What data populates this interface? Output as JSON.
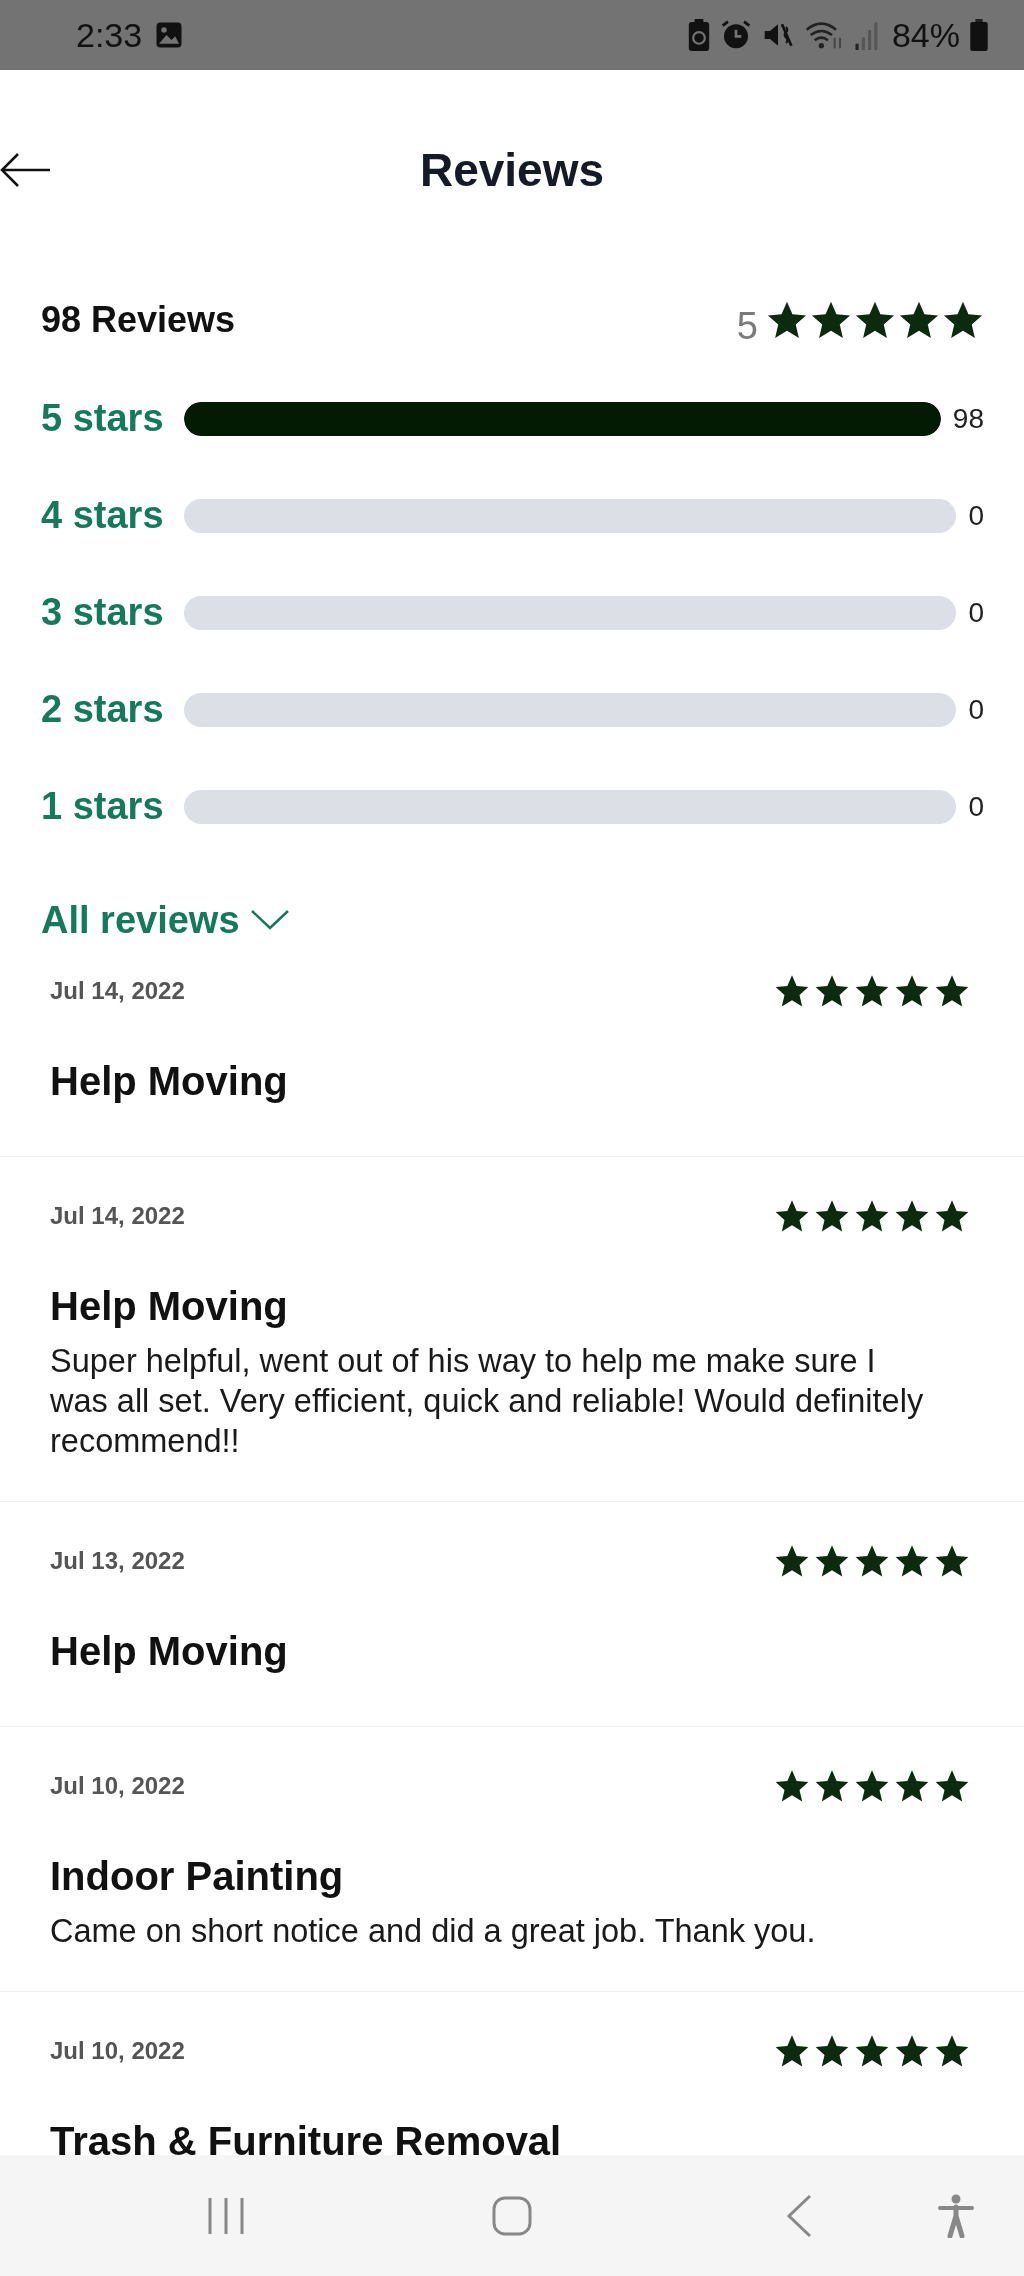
{
  "status_bar": {
    "time": "2:33",
    "battery": "84%"
  },
  "header": {
    "title": "Reviews"
  },
  "summary": {
    "count_label": "98 Reviews",
    "rating": "5",
    "stars": 5,
    "breakdown": [
      {
        "label": "5 stars",
        "level": 1,
        "count": "98"
      },
      {
        "label": "4 stars",
        "level": 0,
        "count": "0"
      },
      {
        "label": "3 stars",
        "level": 0,
        "count": "0"
      },
      {
        "label": "2 stars",
        "level": 0,
        "count": "0"
      },
      {
        "label": "1 stars",
        "level": 0,
        "count": "0"
      }
    ]
  },
  "filter": {
    "label": "All reviews"
  },
  "reviews": [
    {
      "date": "Jul 14, 2022",
      "stars": 5,
      "title": "Help Moving"
    },
    {
      "date": "Jul 14, 2022",
      "stars": 5,
      "title": "Help Moving",
      "text": "Super helpful, went out of his way to help me make sure I was all set. Very efficient, quick and reliable! Would definitely recommend!!"
    },
    {
      "date": "Jul 13, 2022",
      "stars": 5,
      "title": "Help Moving"
    },
    {
      "date": "Jul 10, 2022",
      "stars": 5,
      "title": "Indoor Painting",
      "text": "Came on short notice and did a great job. Thank you."
    },
    {
      "date": "Jul 10, 2022",
      "stars": 5,
      "title": "Trash & Furniture Removal"
    }
  ]
}
